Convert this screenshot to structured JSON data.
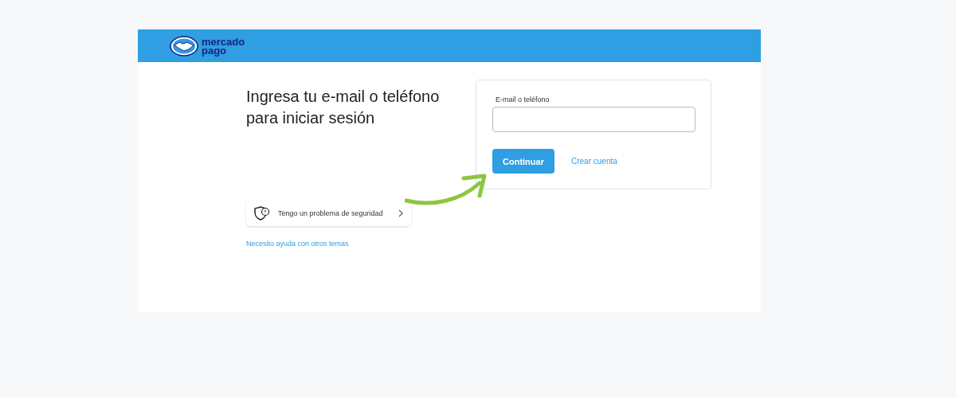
{
  "header": {
    "logo_line_1": "mercado",
    "logo_line_2": "pago"
  },
  "title": "Ingresa tu e-mail o teléfono para iniciar sesión",
  "login_form": {
    "field_label": "E-mail o teléfono",
    "primary_button": "Continuar",
    "secondary_link": "Crear cuenta"
  },
  "security_option": {
    "label": "Tengo un problema de seguridad"
  },
  "help_link": "Necesito ayuda con otros temas"
}
